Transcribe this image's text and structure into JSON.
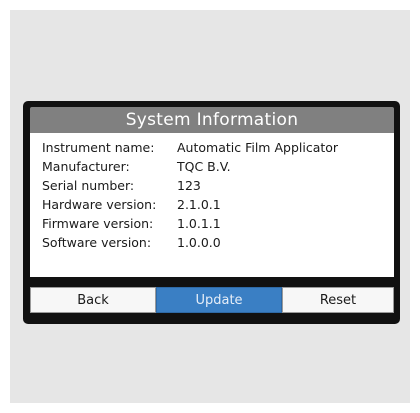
{
  "dialog": {
    "title": "System Information",
    "rows": [
      {
        "label": "Instrument name:",
        "value": "Automatic Film Applicator"
      },
      {
        "label": "Manufacturer:",
        "value": "TQC B.V."
      },
      {
        "label": "Serial number:",
        "value": "123"
      },
      {
        "label": "Hardware version:",
        "value": "2.1.0.1"
      },
      {
        "label": "Firmware version:",
        "value": "1.0.1.1"
      },
      {
        "label": "Software version:",
        "value": "1.0.0.0"
      }
    ]
  },
  "buttons": {
    "back": "Back",
    "update": "Update",
    "reset": "Reset"
  },
  "colors": {
    "title_bar": "#808080",
    "frame": "#111111",
    "update_button": "#3a7fc4",
    "backdrop": "#e6e6e6"
  }
}
